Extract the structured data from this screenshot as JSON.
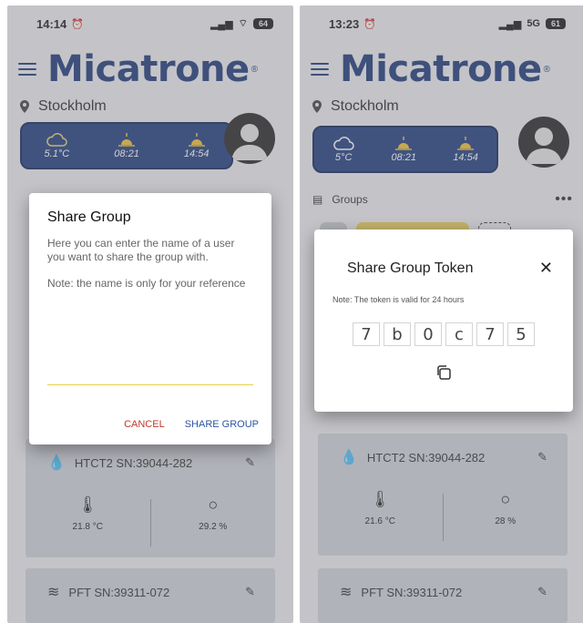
{
  "left": {
    "status": {
      "time": "14:14",
      "signal": " ▐▐",
      "wifi": "≈",
      "battery": "64"
    },
    "brand": {
      "logo": "Micatrone",
      "reg": "®"
    },
    "location": "Stockholm",
    "weather": {
      "temp": "5.1°C",
      "sunrise": "08:21",
      "sunset": "14:54"
    },
    "dialog": {
      "title": "Share Group",
      "description": "Here you can enter the name of a user you want to share the group with.",
      "note": "Note: the name is only for your reference",
      "cancel_label": "CANCEL",
      "share_label": "SHARE GROUP"
    },
    "sensors": [
      {
        "name": "HTCT2 SN:39044-282",
        "temp": "21.8 °C",
        "humidity": "29.2 %"
      },
      {
        "name": "PFT SN:39311-072"
      }
    ]
  },
  "right": {
    "status": {
      "time": "13:23",
      "network": "5G",
      "battery": "61"
    },
    "brand": {
      "logo": "Micatrone",
      "reg": "®"
    },
    "location": "Stockholm",
    "weather": {
      "temp": "5°C",
      "sunrise": "08:21",
      "sunset": "14:54"
    },
    "groups_label": "Groups",
    "dialog": {
      "title": "Share Group Token",
      "note": "Note: The token is valid for 24 hours",
      "token": [
        "7",
        "b",
        "0",
        "c",
        "7",
        "5"
      ]
    },
    "sensors": [
      {
        "name": "HTCT2 SN:39044-282",
        "temp": "21.6 °C",
        "humidity": "28 %"
      },
      {
        "name": "PFT SN:39311-072"
      }
    ]
  },
  "colors": {
    "brand": "#1f3b7a",
    "weather_card": "#233f80",
    "accent_line": "#e9cf46",
    "cancel": "#c0392b",
    "share": "#2b55a3"
  },
  "icons": [
    "hamburger-icon",
    "location-pin-icon",
    "cloud-icon",
    "sunrise-icon",
    "sunset-icon",
    "avatar-icon",
    "groups-icon",
    "more-icon",
    "humidity-temp-icon",
    "edit-icon",
    "thermometer-icon",
    "droplet-icon",
    "airflow-icon",
    "close-icon",
    "copy-icon"
  ]
}
